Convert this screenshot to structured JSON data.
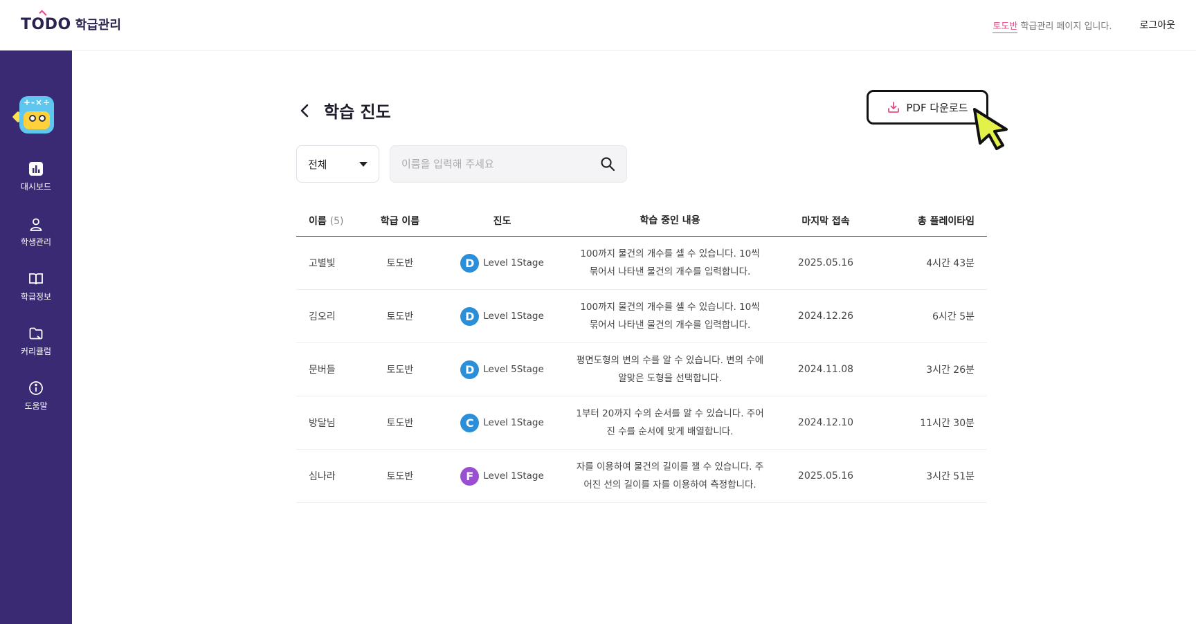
{
  "header": {
    "logo_text": "TODO",
    "logo_sub": "학급관리",
    "notice_class": "토도반",
    "notice_rest": " 학급관리 페이지 입니다.",
    "logout_label": "로그아웃"
  },
  "sidebar": {
    "items": [
      {
        "label": "대시보드",
        "icon": "bar-chart-icon"
      },
      {
        "label": "학생관리",
        "icon": "user-icon"
      },
      {
        "label": "학급정보",
        "icon": "book-icon"
      },
      {
        "label": "커리큘럼",
        "icon": "folder-icon"
      },
      {
        "label": "도움말",
        "icon": "info-icon"
      }
    ],
    "mascot_ops": "+-×÷"
  },
  "page": {
    "title": "학습 진도",
    "pdf_label": "PDF 다운로드"
  },
  "filters": {
    "select_value": "전체",
    "search_placeholder": "이름을 입력해 주세요"
  },
  "table": {
    "headers": {
      "name": "이름",
      "name_count": "(5)",
      "class": "학급 이름",
      "progress": "진도",
      "content": "학습 중인 내용",
      "last": "마지막 접속",
      "time": "총 플레이타임"
    },
    "rows": [
      {
        "name": "고별빛",
        "class": "토도반",
        "grade": "D",
        "level": "Level 1Stage",
        "content_1": "100까지 물건의 개수를 셀 수 있습니다. 10씩",
        "content_2": "묶어서 나타낸 물건의 개수를 입력합니다.",
        "last": "2025.05.16",
        "time": "4시간 43분"
      },
      {
        "name": "김오리",
        "class": "토도반",
        "grade": "D",
        "level": "Level 1Stage",
        "content_1": "100까지 물건의 개수를 셀 수 있습니다. 10씩",
        "content_2": "묶어서 나타낸 물건의 개수를 입력합니다.",
        "last": "2024.12.26",
        "time": "6시간 5분"
      },
      {
        "name": "문버들",
        "class": "토도반",
        "grade": "D",
        "level": "Level 5Stage",
        "content_1": "평면도형의 변의 수를 알 수 있습니다. 변의 수에",
        "content_2": "알맞은 도형을 선택합니다.",
        "last": "2024.11.08",
        "time": "3시간 26분"
      },
      {
        "name": "방달님",
        "class": "토도반",
        "grade": "C",
        "level": "Level 1Stage",
        "content_1": "1부터 20까지 수의 순서를 알 수 있습니다. 주어",
        "content_2": "진 수를 순서에 맞게 배열합니다.",
        "last": "2024.12.10",
        "time": "11시간 30분"
      },
      {
        "name": "심나라",
        "class": "토도반",
        "grade": "F",
        "level": "Level 1Stage",
        "content_1": "자를 이용하여 물건의 길이를 잴 수 있습니다. 주",
        "content_2": "어진 선의 길이를 자를 이용하여 측정합니다.",
        "last": "2025.05.16",
        "time": "3시간 51분"
      }
    ]
  },
  "colors": {
    "sidebar_bg": "#3a2a73",
    "accent_pink": "#e64784",
    "badge_blue": "#2a8fd8",
    "badge_purple": "#9a4fd3",
    "cursor_yellow": "#e3f24a"
  }
}
